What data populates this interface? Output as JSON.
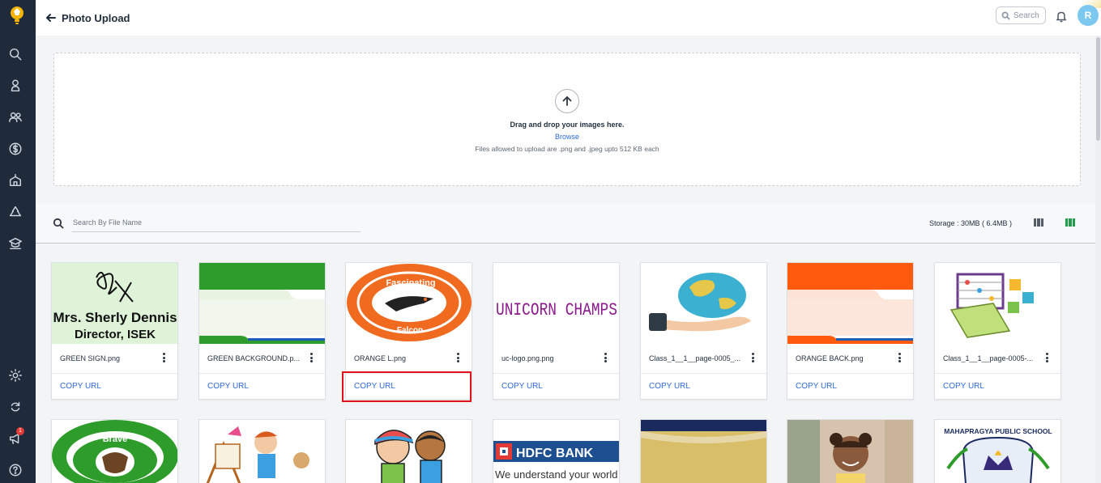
{
  "header": {
    "title": "Photo Upload",
    "search_placeholder": "Search",
    "avatar_initial": "R"
  },
  "sidebar": {
    "icons": [
      "search-icon",
      "user-icon",
      "users-icon",
      "dollar-icon",
      "school-icon",
      "recycle-icon",
      "graduation-icon",
      "settings-icon",
      "sync-icon",
      "announcement-icon",
      "help-icon"
    ],
    "announcement_badge": "1"
  },
  "upload": {
    "drop_text": "Drag and drop your images here.",
    "browse_label": "Browse",
    "allowed_text": "Files allowed to upload are .png and .jpeg upto 512 KB each"
  },
  "toolbar": {
    "search_placeholder": "Search By File Name",
    "storage_text": "Storage : 30MB ( 6.4MB )"
  },
  "files": [
    {
      "name": "GREEN SIGN.png",
      "copy_label": "COPY URL"
    },
    {
      "name": "GREEN BACKGROUND.p...",
      "copy_label": "COPY URL"
    },
    {
      "name": "ORANGE L.png",
      "copy_label": "COPY URL"
    },
    {
      "name": "uc-logo.png.png",
      "copy_label": "COPY URL"
    },
    {
      "name": "Class_1__1__page-0005_...",
      "copy_label": "COPY URL"
    },
    {
      "name": "ORANGE BACK.png",
      "copy_label": "COPY URL"
    },
    {
      "name": "Class_1__1__page-0005-...",
      "copy_label": "COPY URL"
    }
  ],
  "thumb_text": {
    "sign_line1": "Mrs. Sherly Dennis",
    "sign_line2": "Director, ISEK",
    "falcon_top": "Fascinating",
    "falcon_bottom": "Falcon",
    "unicorn": "UNICORN CHAMPS",
    "brave": "Brave",
    "hdfc_title": "HDFC BANK",
    "hdfc_tag": "We understand your world",
    "school_name": "MAHAPRAGYA PUBLIC SCHOOL"
  },
  "colors": {
    "sidebar_bg": "#1f2a3a",
    "accent_blue": "#2f6ad9",
    "grid_active": "#1f9d4a",
    "highlight_red": "#e0121b"
  }
}
